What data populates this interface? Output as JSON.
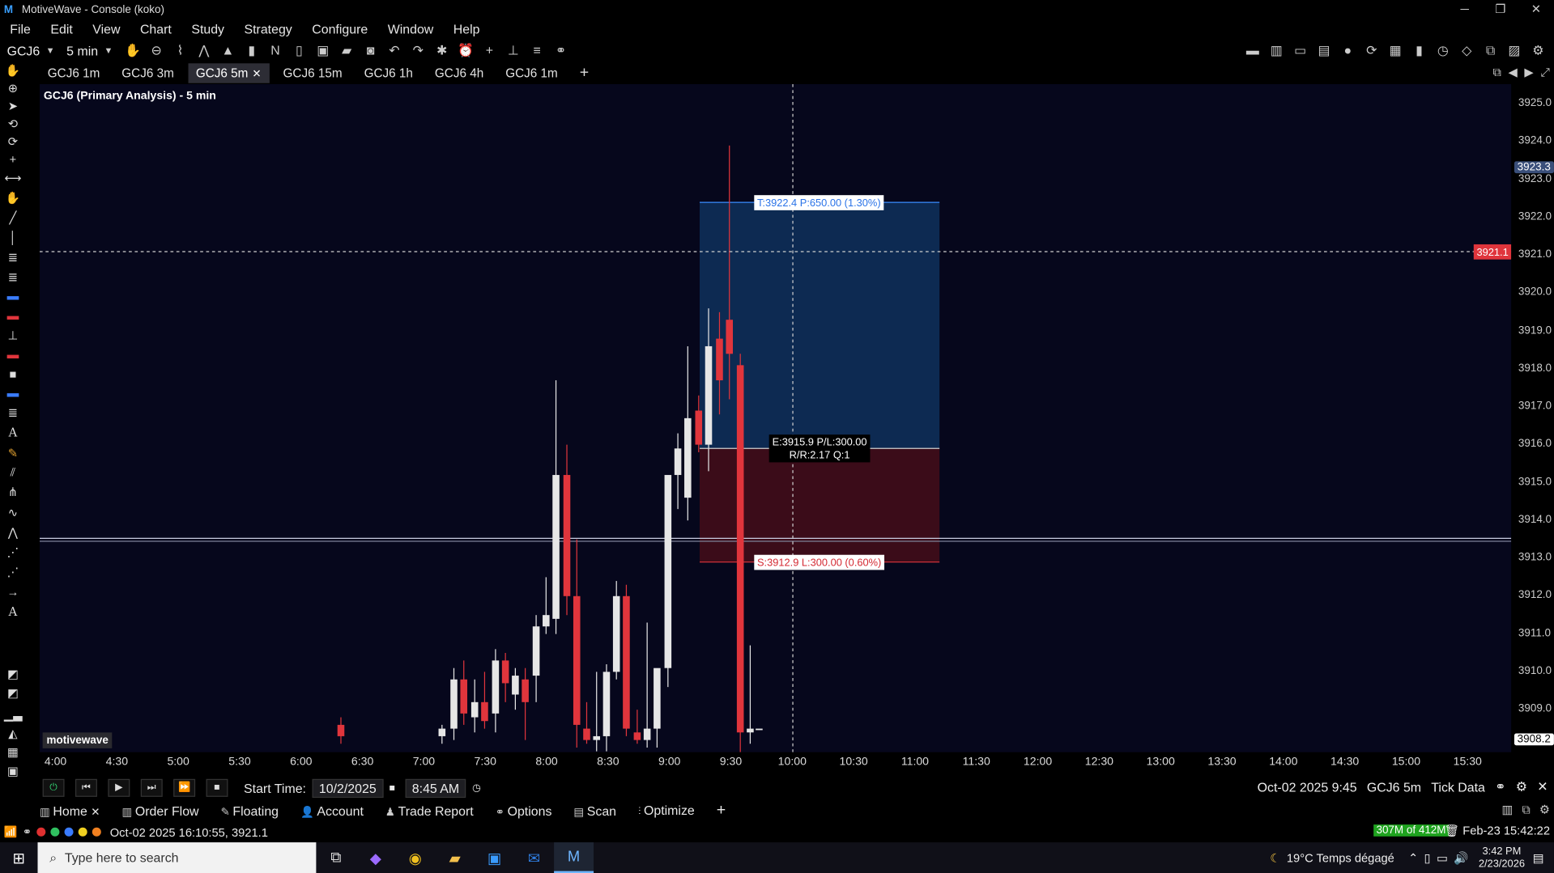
{
  "window": {
    "title": "MotiveWave - Console (koko)"
  },
  "menu": [
    "File",
    "Edit",
    "View",
    "Chart",
    "Study",
    "Strategy",
    "Configure",
    "Window",
    "Help"
  ],
  "toolbar": {
    "symbol": "GCJ6",
    "interval": "5 min",
    "n_label": "N"
  },
  "chart_tabs": [
    {
      "label": "GCJ6 1m",
      "active": false
    },
    {
      "label": "GCJ6 3m",
      "active": false
    },
    {
      "label": "GCJ6 5m",
      "active": true
    },
    {
      "label": "GCJ6 15m",
      "active": false
    },
    {
      "label": "GCJ6 1h",
      "active": false
    },
    {
      "label": "GCJ6 4h",
      "active": false
    },
    {
      "label": "GCJ6 1m",
      "active": false
    }
  ],
  "chart": {
    "title": "GCJ6 (Primary Analysis) - 5 min",
    "watermark": "motivewave",
    "target_label": "T:3922.4 P:650.00 (1.30%)",
    "entry_label_1": "E:3915.9 P/L:300.00",
    "entry_label_2": "R/R:2.17 Q:1",
    "stop_label": "S:3912.9 L:300.00 (0.60%)",
    "price_ticks": [
      "3925.0",
      "3924.0",
      "3923.0",
      "3922.0",
      "3921.0",
      "3920.0",
      "3919.0",
      "3918.0",
      "3917.0",
      "3916.0",
      "3915.0",
      "3914.0",
      "3913.0",
      "3912.0",
      "3911.0",
      "3910.0",
      "3909.0"
    ],
    "last_price_tag": "3923.3",
    "crosshair_price_tag": "3921.1",
    "bottom_price_tag": "3908.2",
    "time_ticks": [
      "4:00",
      "4:30",
      "5:00",
      "5:30",
      "6:00",
      "6:30",
      "7:00",
      "7:30",
      "8:00",
      "8:30",
      "9:00",
      "9:30",
      "10:00",
      "10:30",
      "11:00",
      "11:30",
      "12:00",
      "12:30",
      "13:00",
      "13:30",
      "14:00",
      "14:30",
      "15:00",
      "15:30"
    ],
    "colors": {
      "up": "#e6e6e6",
      "down": "#e0353c",
      "target_zone": "#0d2a52",
      "stop_zone": "#3b0c19",
      "background": "#06071c"
    }
  },
  "playback": {
    "start_time_label": "Start Time:",
    "start_date": "10/2/2025",
    "start_clock": "8:45 AM",
    "current": "Oct-02 2025 9:45",
    "instrument": "GCJ6 5m",
    "data_mode": "Tick Data"
  },
  "bottom_tabs": [
    "Home",
    "Order Flow",
    "Floating",
    "Account",
    "Trade Report",
    "Options",
    "Scan",
    "Optimize"
  ],
  "status": {
    "message": "Oct-02 2025 16:10:55, 3921.1",
    "memory": "307M of 412M",
    "clock": "Feb-23 15:42:22"
  },
  "taskbar": {
    "search_placeholder": "Type here to search",
    "weather": "19°C  Temps dégagé",
    "time": "3:42 PM",
    "date": "2/23/2026"
  }
}
